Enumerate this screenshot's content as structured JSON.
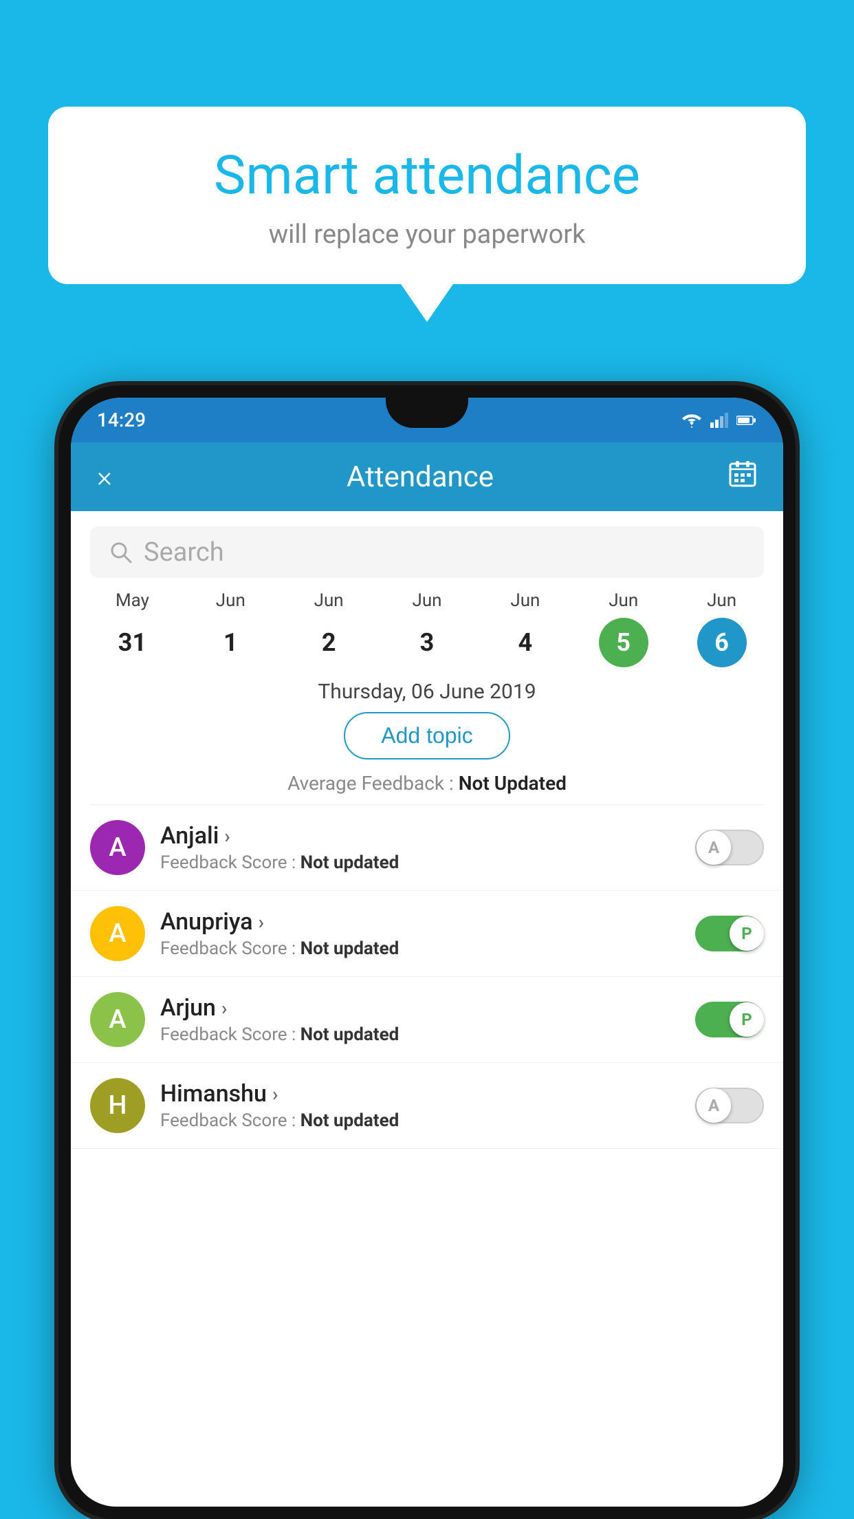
{
  "background_color": "#1ab8e8",
  "bubble": {
    "title": "Smart attendance",
    "subtitle": "will replace your paperwork"
  },
  "status_bar": {
    "time": "14:29"
  },
  "header": {
    "title": "Attendance",
    "close_label": "×",
    "calendar_label": "📅"
  },
  "search": {
    "placeholder": "Search"
  },
  "calendar": {
    "days": [
      {
        "month": "May",
        "date": "31",
        "style": "normal"
      },
      {
        "month": "Jun",
        "date": "1",
        "style": "normal"
      },
      {
        "month": "Jun",
        "date": "2",
        "style": "normal"
      },
      {
        "month": "Jun",
        "date": "3",
        "style": "normal"
      },
      {
        "month": "Jun",
        "date": "4",
        "style": "normal"
      },
      {
        "month": "Jun",
        "date": "5",
        "style": "green"
      },
      {
        "month": "Jun",
        "date": "6",
        "style": "blue"
      }
    ]
  },
  "selected_date": "Thursday, 06 June 2019",
  "add_topic_label": "Add topic",
  "avg_feedback_label": "Average Feedback : ",
  "avg_feedback_value": "Not Updated",
  "students": [
    {
      "name": "Anjali",
      "feedback_label": "Feedback Score : ",
      "feedback_value": "Not updated",
      "avatar_letter": "A",
      "avatar_class": "avatar-purple",
      "toggle": "off",
      "toggle_letter": "A"
    },
    {
      "name": "Anupriya",
      "feedback_label": "Feedback Score : ",
      "feedback_value": "Not updated",
      "avatar_letter": "A",
      "avatar_class": "avatar-yellow",
      "toggle": "on",
      "toggle_letter": "P"
    },
    {
      "name": "Arjun",
      "feedback_label": "Feedback Score : ",
      "feedback_value": "Not updated",
      "avatar_letter": "A",
      "avatar_class": "avatar-green",
      "toggle": "on",
      "toggle_letter": "P"
    },
    {
      "name": "Himanshu",
      "feedback_label": "Feedback Score : ",
      "feedback_value": "Not updated",
      "avatar_letter": "H",
      "avatar_class": "avatar-olive",
      "toggle": "off",
      "toggle_letter": "A"
    }
  ]
}
